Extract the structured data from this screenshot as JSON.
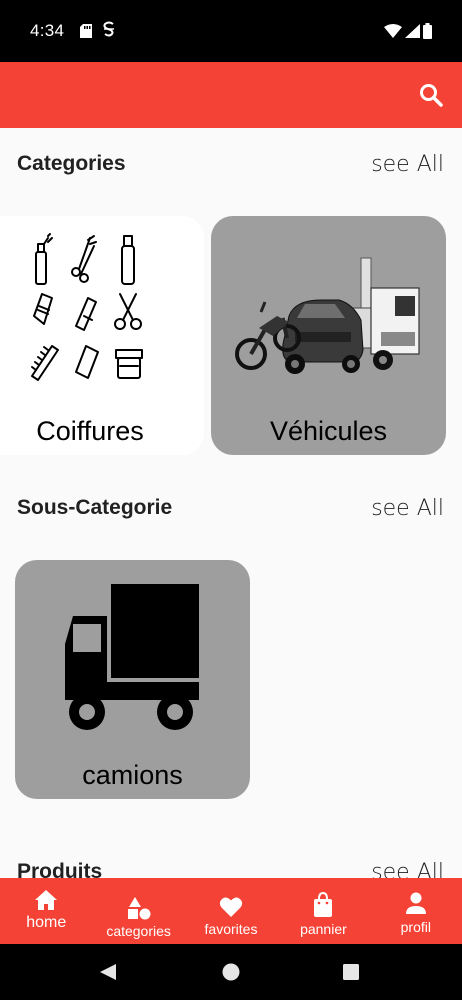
{
  "status_bar": {
    "time": "4:34"
  },
  "app_bar": {
    "search_icon": "search-icon"
  },
  "sections": {
    "categories": {
      "title": "Categories",
      "see_all": "see All"
    },
    "sous_categorie": {
      "title": "Sous-Categorie",
      "see_all": "see All"
    },
    "produits": {
      "title": "Produits",
      "see_all": "see All"
    }
  },
  "categories": [
    {
      "label": "Coiffures",
      "image": "hairdressing-tools"
    },
    {
      "label": "Véhicules",
      "image": "motorbike-car-truck"
    }
  ],
  "sous_categories": [
    {
      "label": "camions",
      "image": "truck-icon"
    }
  ],
  "bottom_nav": [
    {
      "label": "home",
      "icon": "home-icon",
      "active": true
    },
    {
      "label": "categories",
      "icon": "shapes-icon",
      "active": false
    },
    {
      "label": "favorites",
      "icon": "heart-icon",
      "active": false
    },
    {
      "label": "pannier",
      "icon": "shopping-bag-icon",
      "active": false
    },
    {
      "label": "profil",
      "icon": "person-icon",
      "active": false
    }
  ],
  "colors": {
    "accent": "#f44336",
    "card_grey": "#9e9e9e",
    "background": "#fafafa"
  }
}
